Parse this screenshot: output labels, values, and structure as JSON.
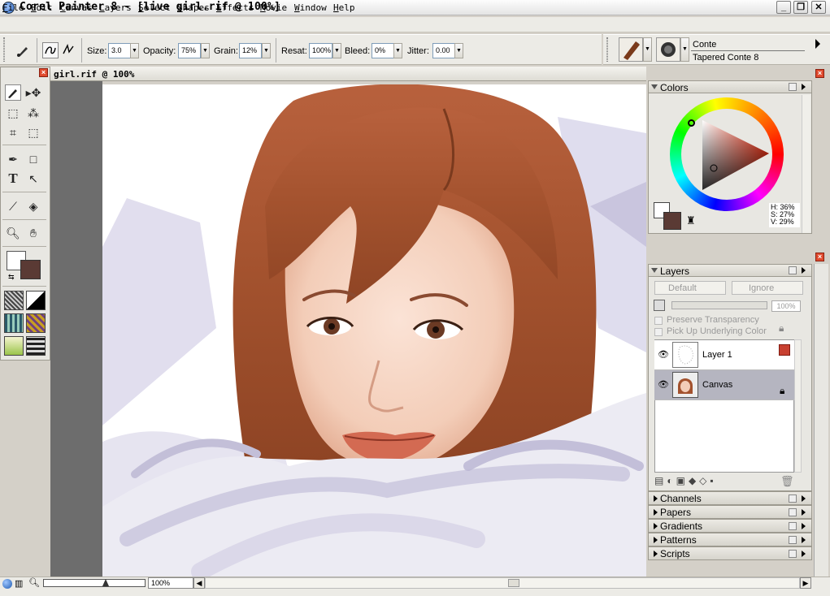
{
  "window": {
    "title": "Corel Painter 8 - [live girl.rif @ 100%]",
    "minimize": "_",
    "restore": "❐",
    "close": "✕"
  },
  "menu": [
    "File",
    "Edit",
    "Canvas",
    "Layers",
    "Select",
    "Shapes",
    "Effects",
    "Movie",
    "Window",
    "Help"
  ],
  "property_bar": {
    "size_label": "Size:",
    "size_value": "3.0",
    "opacity_label": "Opacity:",
    "opacity_value": "75%",
    "grain_label": "Grain:",
    "grain_value": "12%",
    "resat_label": "Resat:",
    "resat_value": "100%",
    "bleed_label": "Bleed:",
    "bleed_value": "0%",
    "jitter_label": "Jitter:",
    "jitter_value": "0.00"
  },
  "brush_selector": {
    "category": "Conte",
    "variant": "Tapered Conte 8"
  },
  "document": {
    "title": "girl.rif @ 100%"
  },
  "colors_palette": {
    "title": "Colors",
    "h": "H: 36%",
    "s": "S: 27%",
    "v": "V: 29%",
    "main_color": "#5a3a34",
    "secondary_color": "#ffffff"
  },
  "layers_palette": {
    "title": "Layers",
    "composite_method": "Default",
    "composite_depth": "Ignore",
    "opacity": "100%",
    "preserve_transparency": "Preserve Transparency",
    "pick_up_color": "Pick Up Underlying Color",
    "layers": [
      {
        "name": "Layer 1"
      },
      {
        "name": "Canvas"
      }
    ]
  },
  "collapsed_palettes": [
    "Channels",
    "Papers",
    "Gradients",
    "Patterns",
    "Scripts"
  ],
  "status": {
    "zoom": "100%"
  }
}
